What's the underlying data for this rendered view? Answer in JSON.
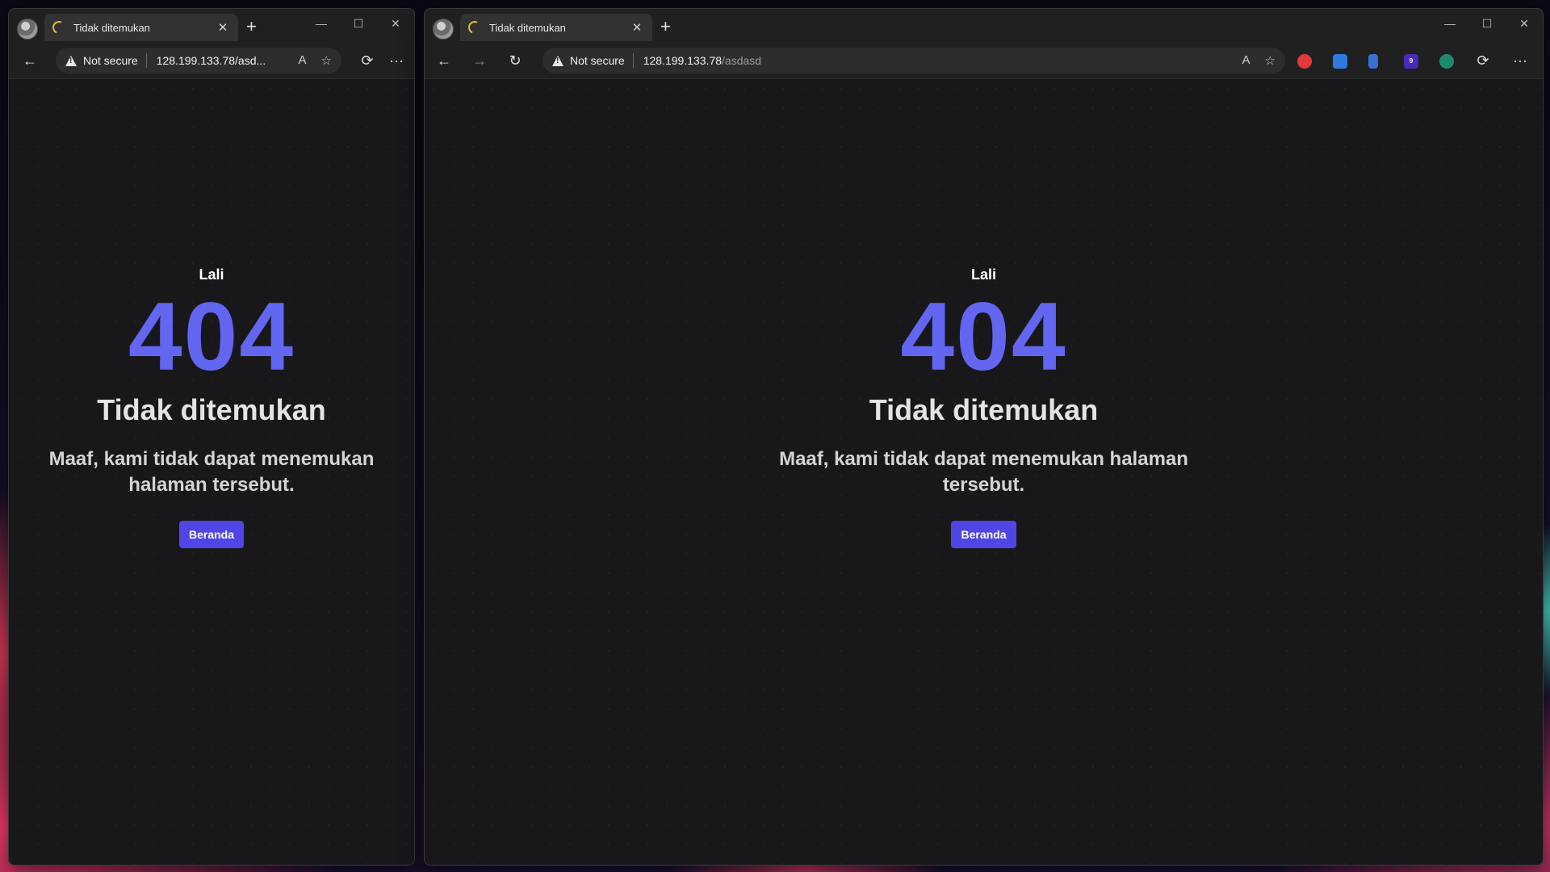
{
  "left_window": {
    "tab": {
      "title": "Tidak ditemukan",
      "close": "✕"
    },
    "new_tab": "+",
    "window_controls": {
      "minimize": "—",
      "maximize": "☐",
      "close": "✕"
    },
    "toolbar": {
      "back": "←",
      "read_aloud": "A",
      "favorite": "☆",
      "extensions": "⟳",
      "more": "···"
    },
    "address": {
      "security": "Not secure",
      "url": "128.199.133.78/asd..."
    },
    "page": {
      "brand": "Lali",
      "code": "404",
      "title": "Tidak ditemukan",
      "message": "Maaf, kami tidak dapat menemukan halaman tersebut.",
      "button": "Beranda"
    }
  },
  "right_window": {
    "tab": {
      "title": "Tidak ditemukan",
      "close": "✕"
    },
    "new_tab": "+",
    "window_controls": {
      "minimize": "—",
      "maximize": "☐",
      "close": "✕"
    },
    "toolbar": {
      "back": "←",
      "forward": "→",
      "refresh": "↻",
      "read_aloud": "A",
      "favorite": "☆",
      "extensions": "⟳",
      "more": "···"
    },
    "address": {
      "security": "Not secure",
      "url_host": "128.199.133.78",
      "url_path": "/asdasd"
    },
    "extension_badges": {
      "badge_count": "9"
    },
    "page": {
      "brand": "Lali",
      "code": "404",
      "title": "Tidak ditemukan",
      "message": "Maaf, kami tidak dapat menemukan halaman tersebut.",
      "button": "Beranda"
    }
  },
  "colors": {
    "accent": "#6266f1",
    "button": "#4f46e5",
    "background": "#18181b"
  }
}
